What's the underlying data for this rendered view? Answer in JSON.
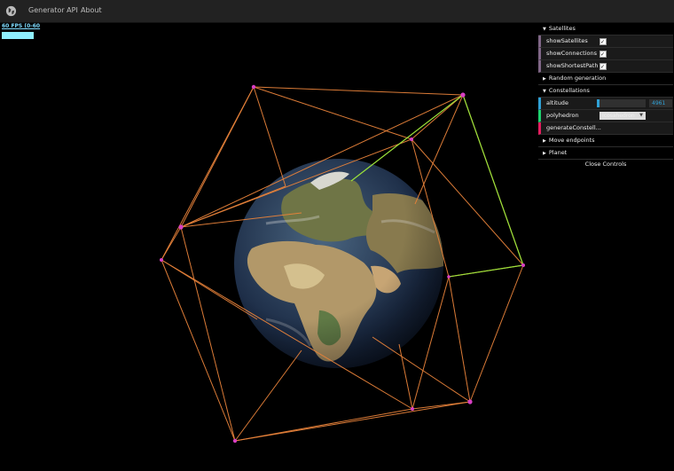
{
  "nav": {
    "logo": "globe-icon",
    "links": [
      "Generator API",
      "About"
    ]
  },
  "stats": {
    "fps_text": "60 FPS (0-60"
  },
  "gui": {
    "folders": {
      "satellites": "Satellites",
      "random": "Random generation",
      "constellations": "Constellations",
      "move": "Move endpoints",
      "planet": "Planet"
    },
    "satellites": {
      "showSatellites": "showSatellites",
      "showConnections": "showConnections",
      "showShortestPath": "showShortestPath"
    },
    "constellations": {
      "altitude_label": "altitude",
      "altitude_value": "4961",
      "altitude_fraction": 0.05,
      "polyhedron_label": "polyhedron",
      "polyhedron_value": "Icosahedron",
      "generate_label": "generateConstell..."
    },
    "close": "Close Controls"
  },
  "colors": {
    "edge": "#e7823a",
    "node": "#d93fc4",
    "path": "#9be23a",
    "fps": "#7fdcff"
  }
}
